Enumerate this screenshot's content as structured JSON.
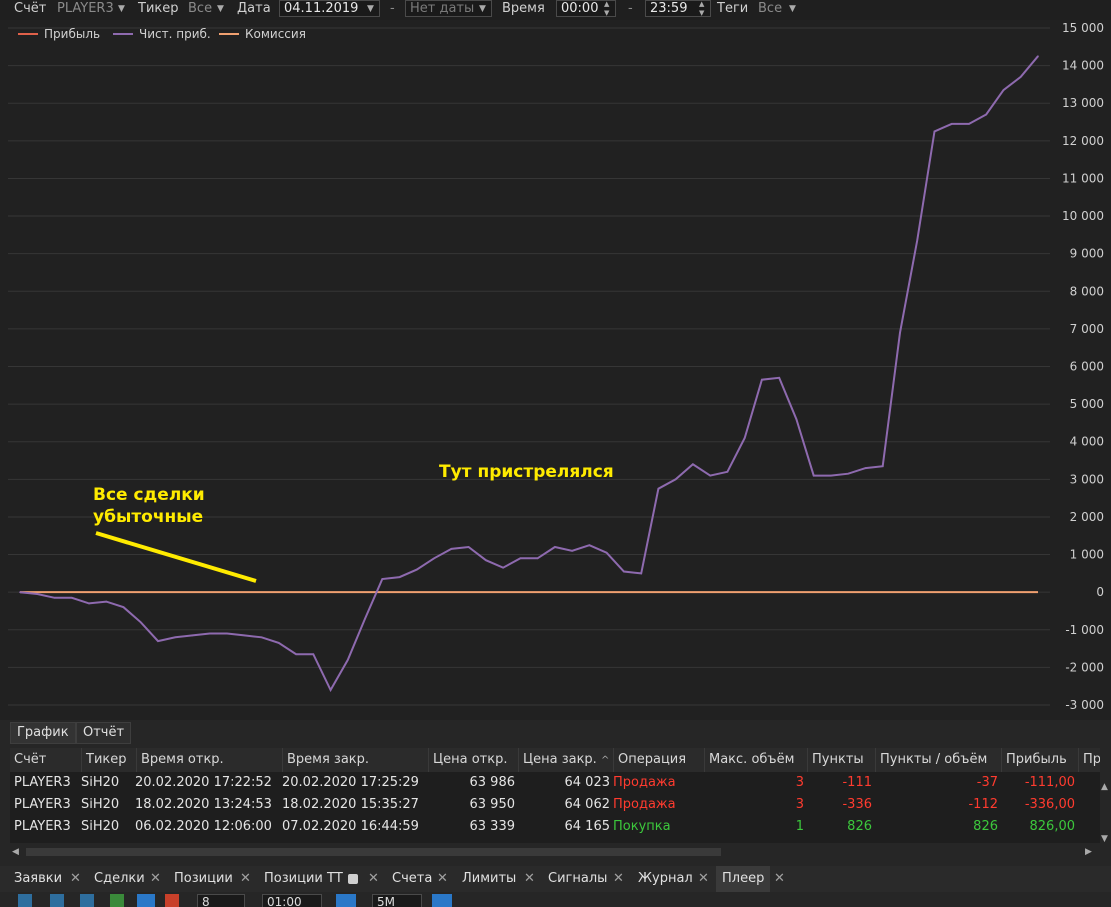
{
  "filters": {
    "account_label": "Счёт",
    "account_value": "PLAYER3",
    "ticker_label": "Тикер",
    "ticker_value": "Все",
    "date_label": "Дата",
    "date_from": "04.11.2019",
    "date_dash": "-",
    "date_to": "Нет даты",
    "time_label": "Время",
    "time_from": "00:00",
    "time_dash": "-",
    "time_to": "23:59",
    "tags_label": "Теги",
    "tags_value": "Все"
  },
  "annotations": {
    "left_line1": "Все сделки",
    "left_line2": "убыточные",
    "mid": "Тут пристрелялся",
    "highlight_color": "#ffeb00"
  },
  "chart_data": {
    "type": "line",
    "series": [
      {
        "name": "Прибыль",
        "color": "#e0614a",
        "values": []
      },
      {
        "name": "Чист. приб.",
        "color": "#8e6aaf",
        "values": [
          0,
          -50,
          -150,
          -150,
          -300,
          -250,
          -400,
          -800,
          -1300,
          -1200,
          -1150,
          -1100,
          -1100,
          -1150,
          -1200,
          -1350,
          -1650,
          -1650,
          -2600,
          -1800,
          -700,
          350,
          400,
          600,
          900,
          1150,
          1200,
          850,
          650,
          900,
          900,
          1200,
          1100,
          1250,
          1050,
          550,
          500,
          2750,
          3000,
          3400,
          3100,
          3200,
          4100,
          5650,
          5700,
          4600,
          3100,
          3100,
          3150,
          3300,
          3350,
          6900,
          9350,
          12250,
          12450,
          12450,
          12700,
          13350,
          13700,
          14250
        ]
      },
      {
        "name": "Комиссия",
        "color": "#f0a070",
        "values": [
          0,
          0
        ]
      }
    ],
    "ylim": [
      -3000,
      15000
    ],
    "yticks": [
      "-3 000",
      "-2 000",
      "-1 000",
      "0",
      "1 000",
      "2 000",
      "3 000",
      "4 000",
      "5 000",
      "6 000",
      "7 000",
      "8 000",
      "9 000",
      "10 000",
      "11 000",
      "12 000",
      "13 000",
      "14 000",
      "15 000"
    ],
    "grid": true,
    "legend_position": "top-left"
  },
  "tabs": {
    "chart": "График",
    "report": "Отчёт"
  },
  "table": {
    "headers": [
      "Счёт",
      "Тикер",
      "Время откр.",
      "Время закр.",
      "Цена откр.",
      "Цена закр.",
      "Операция",
      "Макс. объём",
      "Пункты",
      "Пункты / объём",
      "Прибыль",
      "Пр"
    ],
    "sort_glyph": "^",
    "rows": [
      {
        "account": "PLAYER3",
        "ticker": "SiH20",
        "open_time": "20.02.2020 17:22:52",
        "close_time": "20.02.2020 17:25:29",
        "open_price": "63 986",
        "close_price": "64 023",
        "operation": "Продажа",
        "max_volume": "3",
        "points": "-111",
        "points_per_volume": "-37",
        "profit": "-111,00",
        "sign": "neg"
      },
      {
        "account": "PLAYER3",
        "ticker": "SiH20",
        "open_time": "18.02.2020 13:24:53",
        "close_time": "18.02.2020 15:35:27",
        "open_price": "63 950",
        "close_price": "64 062",
        "operation": "Продажа",
        "max_volume": "3",
        "points": "-336",
        "points_per_volume": "-112",
        "profit": "-336,00",
        "sign": "neg"
      },
      {
        "account": "PLAYER3",
        "ticker": "SiH20",
        "open_time": "06.02.2020 12:06:00",
        "close_time": "07.02.2020 16:44:59",
        "open_price": "63 339",
        "close_price": "64 165",
        "operation": "Покупка",
        "max_volume": "1",
        "points": "826",
        "points_per_volume": "826",
        "profit": "826,00",
        "sign": "pos"
      }
    ]
  },
  "bottom_tabs": [
    "Заявки",
    "Сделки",
    "Позиции",
    "Позиции ТТ",
    "Счета",
    "Лимиты",
    "Сигналы",
    "Журнал",
    "Плеер"
  ],
  "toolbar": {
    "count": "8",
    "time": "01:00",
    "speed": "5M"
  }
}
